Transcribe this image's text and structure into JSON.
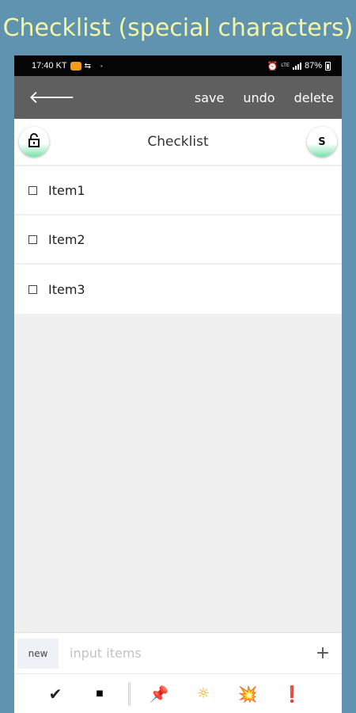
{
  "banner": {
    "title": "Checklist (special characters)"
  },
  "statusbar": {
    "time_carrier": "17:40 KT",
    "battery": "87%",
    "network": "LTE"
  },
  "appbar": {
    "back_icon": "arrow-left-icon",
    "save": "save",
    "undo": "undo",
    "delete": "delete"
  },
  "titlebar": {
    "title": "Checklist",
    "lock_icon": "lock-open-icon",
    "s_button": "S"
  },
  "items": [
    {
      "label": "Item1",
      "checked": false
    },
    {
      "label": "Item2",
      "checked": false
    },
    {
      "label": "Item3",
      "checked": false
    }
  ],
  "input": {
    "new_label": "new",
    "placeholder": "input items",
    "value": "",
    "add_icon": "plus-icon"
  },
  "toolbar": {
    "check": "✔",
    "square": "■",
    "pin": "📌",
    "sun": "☼",
    "boom": "💥",
    "exclamation": "❗"
  },
  "colors": {
    "background": "#5f93b0",
    "banner_text": "#f3f6a6",
    "appbar": "#5f5f5f",
    "statusbar": "#050505"
  }
}
